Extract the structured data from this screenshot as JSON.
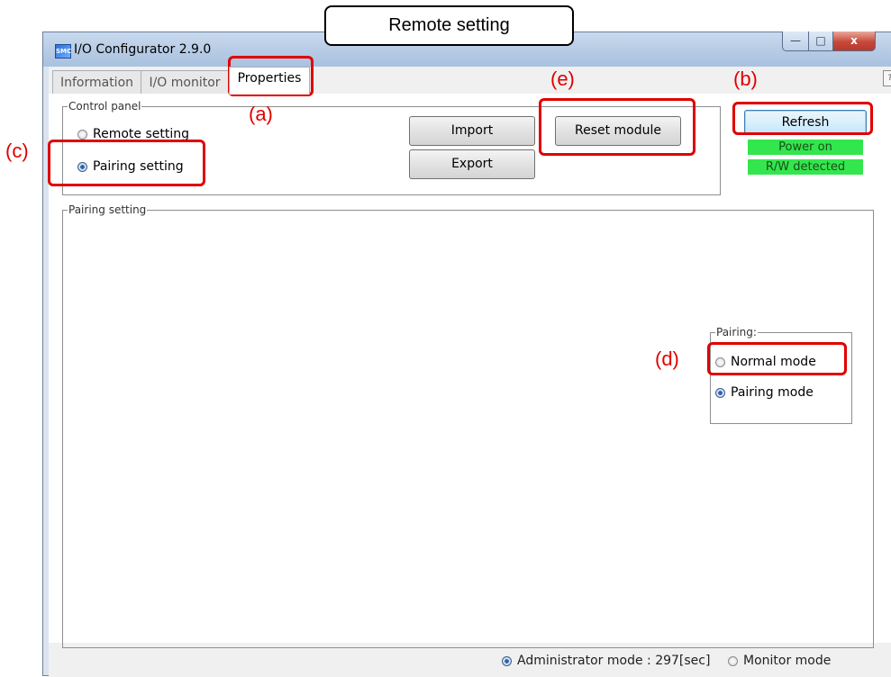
{
  "callout": {
    "text": "Remote setting"
  },
  "window": {
    "title": "I/O Configurator 2.9.0",
    "icon_name": "app-icon",
    "controls": {
      "minimize": "—",
      "maximize": "□",
      "close": "x"
    }
  },
  "tabs": [
    {
      "label": "Information"
    },
    {
      "label": "I/O monitor"
    },
    {
      "label": "Properties",
      "active": true
    }
  ],
  "help_label": "?",
  "control_panel": {
    "legend": "Control panel",
    "remote_setting": "Remote setting",
    "pairing_setting": "Pairing setting",
    "selected": "Pairing setting",
    "import_label": "Import",
    "export_label": "Export",
    "reset_label": "Reset module",
    "refresh_label": "Refresh",
    "status_power": "Power on",
    "status_rw": "R/W detected"
  },
  "pairing_setting": {
    "legend": "Pairing setting",
    "pairing_group": {
      "legend": "Pairing:",
      "normal_mode": "Normal mode",
      "pairing_mode": "Pairing mode",
      "selected": "Pairing mode"
    }
  },
  "bottom_bar": {
    "admin_mode": "Administrator mode : 297[sec]",
    "monitor_mode": "Monitor mode",
    "selected": "Administrator mode"
  },
  "annotations": {
    "a": "(a)",
    "b": "(b)",
    "c": "(c)",
    "d": "(d)",
    "e": "(e)"
  },
  "colors": {
    "annotation": "#e00000",
    "status_green": "#33e64d",
    "title_bar": "#b6cbe5",
    "close_button": "#c6493a"
  }
}
